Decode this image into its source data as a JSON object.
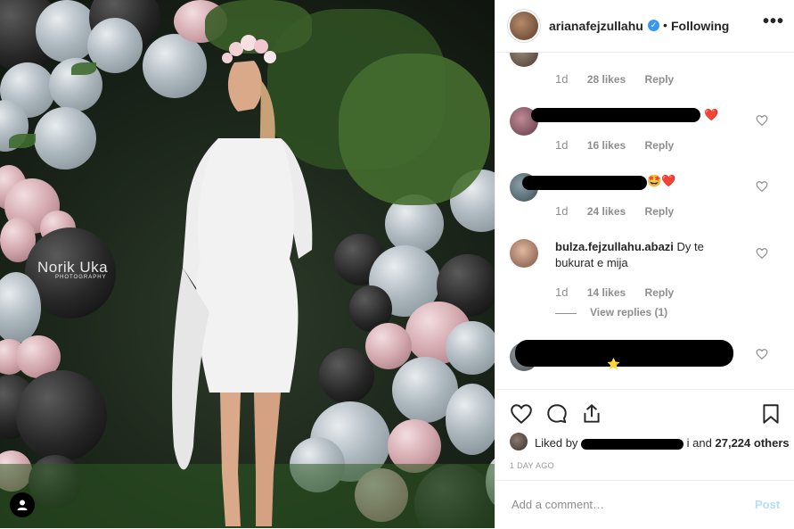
{
  "photo": {
    "watermark": "Norik Uka",
    "watermark_sub": "PHOTOGRAPHY"
  },
  "header": {
    "username": "arianafejzullahu",
    "separator": "•",
    "follow_status": "Following",
    "more": "•••"
  },
  "comments": [
    {
      "username": "",
      "text": "",
      "time": "1d",
      "likes": "28 likes",
      "reply": "Reply"
    },
    {
      "username": "",
      "text": "",
      "emoji": "❤️",
      "time": "1d",
      "likes": "16 likes",
      "reply": "Reply"
    },
    {
      "username": "",
      "text": "",
      "emoji": "🤩❤️",
      "time": "1d",
      "likes": "24 likes",
      "reply": "Reply"
    },
    {
      "username": "bulza.fejzullahu.abazi",
      "text": "Dy te bukurat e mija",
      "time": "1d",
      "likes": "14 likes",
      "reply": "Reply",
      "view_replies": "View replies (1)"
    },
    {
      "username": "",
      "text": "",
      "emoji": "⭐",
      "time": "",
      "likes": "",
      "reply": ""
    }
  ],
  "post_info": {
    "liked_prefix": "Liked by",
    "liked_suffix": "i and",
    "likes_count": "27,224 others",
    "ago": "1 DAY AGO"
  },
  "add_comment": {
    "placeholder": "Add a comment…",
    "post_label": "Post"
  },
  "colors": {
    "accent": "#3897f0",
    "post_disabled": "#b2dffc",
    "heart_red": "#ed4956"
  }
}
